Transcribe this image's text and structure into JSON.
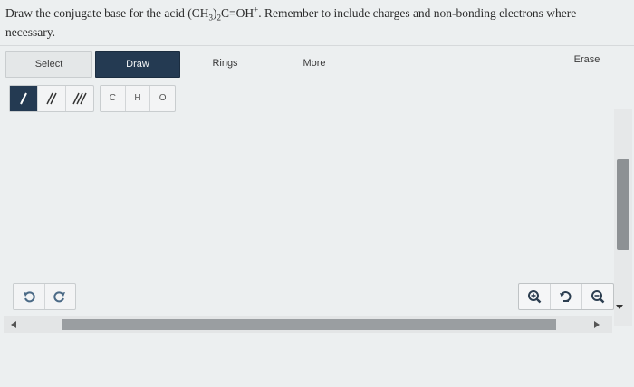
{
  "question": {
    "prefix": "Draw the conjugate base for the acid (CH",
    "sub1": "3",
    "mid1": ")",
    "sub2": "2",
    "mid2": "C=OH",
    "sup": "+",
    "suffix": ". Remember to include charges and non-bonding electrons where necessary."
  },
  "toolbar": {
    "select_label": "Select",
    "draw_label": "Draw",
    "rings_label": "Rings",
    "more_label": "More",
    "erase_label": "Erase",
    "active_tool": "Draw"
  },
  "bonds": [
    {
      "name": "single-bond",
      "active": true
    },
    {
      "name": "double-bond",
      "active": false
    },
    {
      "name": "triple-bond",
      "active": false
    }
  ],
  "atoms": {
    "a1": "C",
    "a2": "H",
    "a3": "O"
  },
  "history": [
    "undo-icon",
    "redo-icon"
  ],
  "zoom": [
    "zoom-in-icon",
    "reset-zoom-icon",
    "zoom-out-icon"
  ],
  "colors": {
    "accent": "#243a52",
    "background": "#eceff0"
  }
}
